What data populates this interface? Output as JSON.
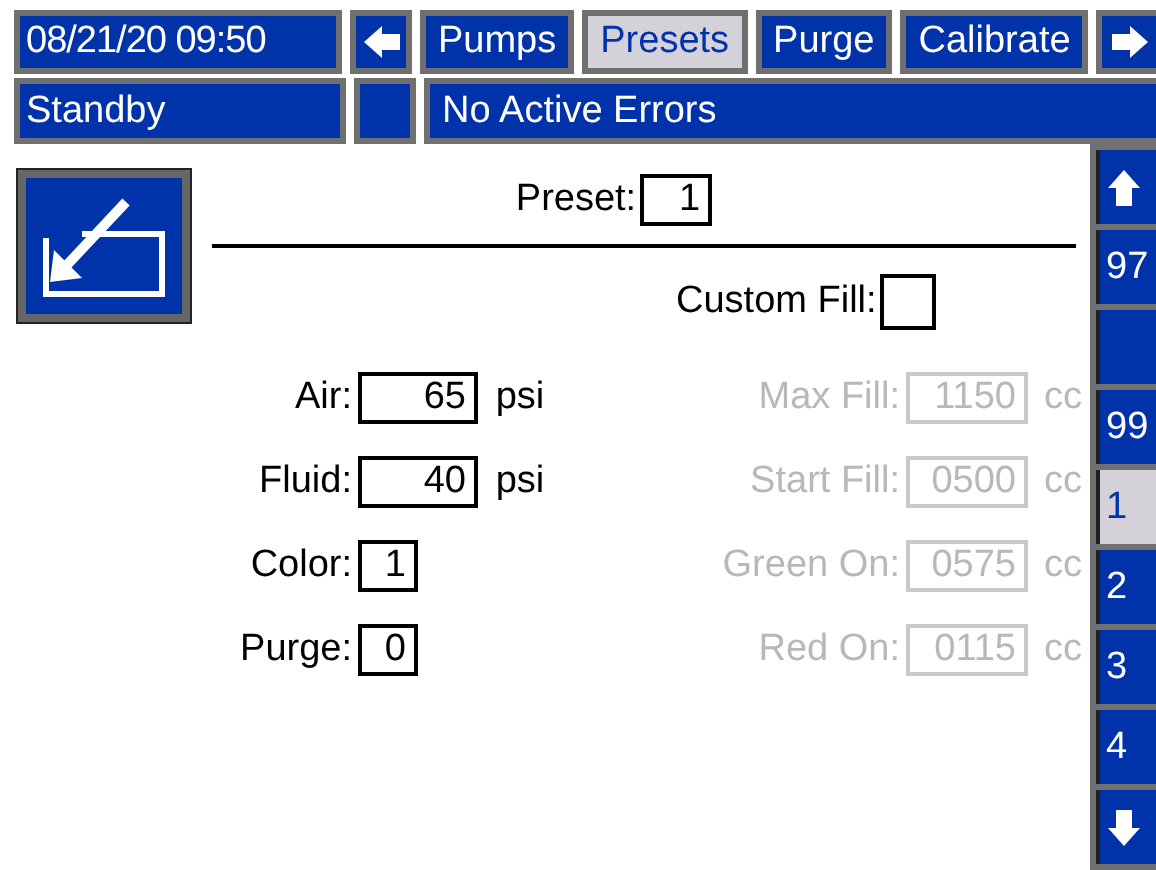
{
  "header": {
    "datetime": "08/21/20 09:50",
    "tabs": [
      {
        "kind": "prev"
      },
      {
        "kind": "tab",
        "label": "Pumps",
        "selected": false
      },
      {
        "kind": "tab",
        "label": "Presets",
        "selected": true
      },
      {
        "kind": "tab",
        "label": "Purge",
        "selected": false
      },
      {
        "kind": "tab",
        "label": "Calibrate",
        "selected": false
      },
      {
        "kind": "next"
      }
    ]
  },
  "status": {
    "mode": "Standby",
    "errors": "No Active Errors"
  },
  "preset": {
    "label": "Preset:",
    "value": "1"
  },
  "custom_fill": {
    "label": "Custom Fill:",
    "checked": false
  },
  "left_fields": [
    {
      "label": "Air:",
      "value": "65",
      "unit": "psi",
      "disabled": false
    },
    {
      "label": "Fluid:",
      "value": "40",
      "unit": "psi",
      "disabled": false
    },
    {
      "label": "Color:",
      "value": "1",
      "disabled": false
    },
    {
      "label": "Purge:",
      "value": "0",
      "disabled": false
    }
  ],
  "right_fields": [
    {
      "label": "Max Fill:",
      "value": "1150",
      "unit": "cc",
      "disabled": true
    },
    {
      "label": "Start Fill:",
      "value": "0500",
      "unit": "cc",
      "disabled": true
    },
    {
      "label": "Green On:",
      "value": "0575",
      "unit": "cc",
      "disabled": true
    },
    {
      "label": "Red On:",
      "value": "0115",
      "unit": "cc",
      "disabled": true
    }
  ],
  "preset_list": [
    {
      "kind": "up"
    },
    {
      "kind": "item",
      "label": "97",
      "selected": false
    },
    {
      "kind": "blank"
    },
    {
      "kind": "item",
      "label": "99",
      "selected": false
    },
    {
      "kind": "item",
      "label": "1",
      "selected": true
    },
    {
      "kind": "item",
      "label": "2",
      "selected": false
    },
    {
      "kind": "item",
      "label": "3",
      "selected": false
    },
    {
      "kind": "item",
      "label": "4",
      "selected": false
    },
    {
      "kind": "down"
    }
  ]
}
